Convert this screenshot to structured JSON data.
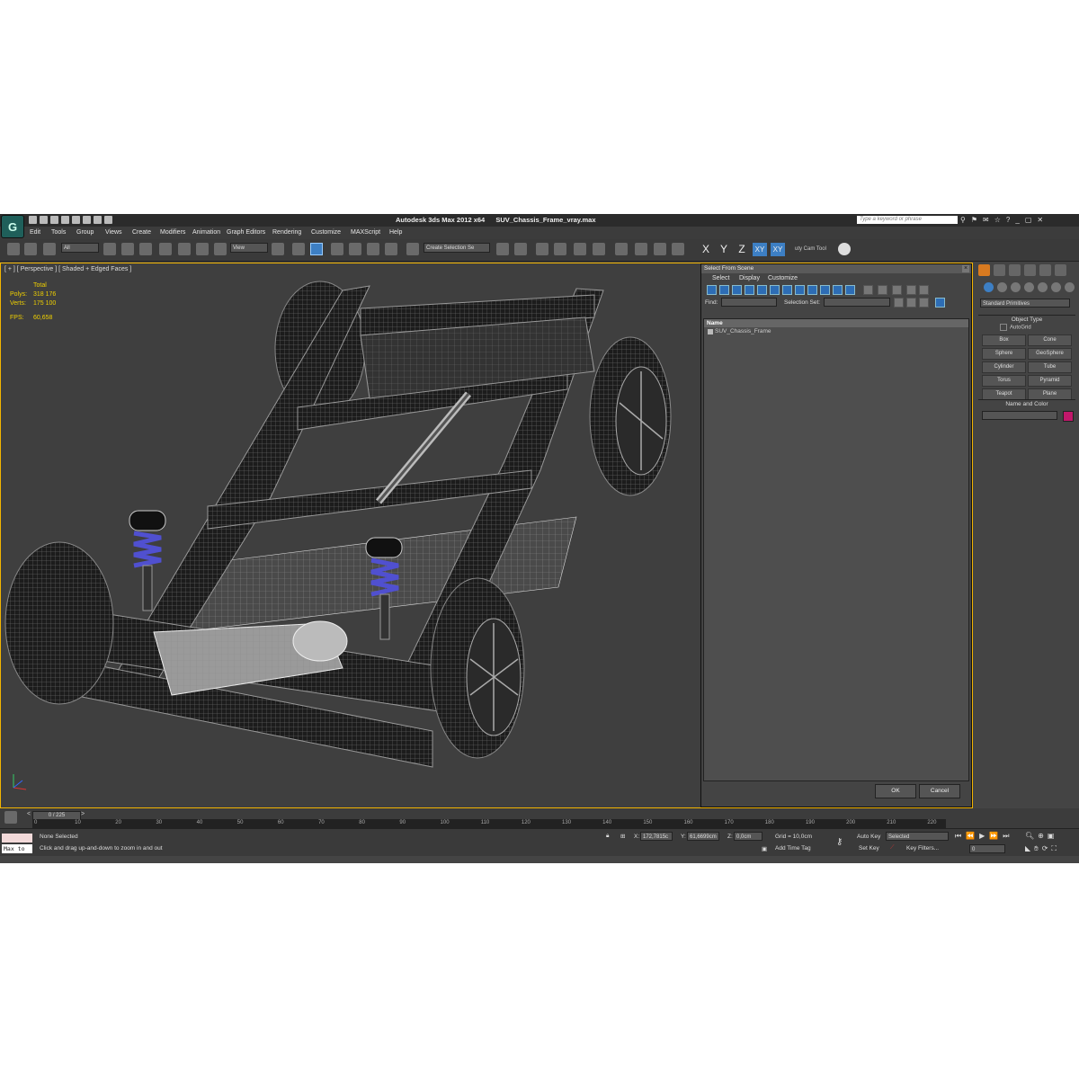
{
  "titlebar": {
    "app": "Autodesk 3ds Max  2012 x64",
    "file": "SUV_Chassis_Frame_vray.max",
    "search_placeholder": "Type a keyword or phrase"
  },
  "menu": [
    "Edit",
    "Tools",
    "Group",
    "Views",
    "Create",
    "Modifiers",
    "Animation",
    "Graph Editors",
    "Rendering",
    "Customize",
    "MAXScript",
    "Help"
  ],
  "toolbar": {
    "filter": "All",
    "ref_coord": "View",
    "selection_set": "Create Selection Se",
    "axis": [
      "X",
      "Y",
      "Z",
      "XY",
      "XY"
    ],
    "plugin_label": "uty Cam Tool"
  },
  "viewport": {
    "label": "[ + ] [ Perspective ] [ Shaded + Edged Faces ]",
    "stats": {
      "header": "Total",
      "polys_label": "Polys:",
      "polys": "318 176",
      "verts_label": "Verts:",
      "verts": "175 100",
      "fps_label": "FPS:",
      "fps": "60,658"
    }
  },
  "dialog": {
    "title": "Select From Scene",
    "menu": [
      "Select",
      "Display",
      "Customize"
    ],
    "find_label": "Find:",
    "selection_set_label": "Selection Set:",
    "column": "Name",
    "items": [
      "SUV_Chassis_Frame"
    ],
    "ok": "OK",
    "cancel": "Cancel"
  },
  "command_panel": {
    "category": "Standard Primitives",
    "object_type_title": "Object Type",
    "autogrid": "AutoGrid",
    "primitives": [
      "Box",
      "Cone",
      "Sphere",
      "GeoSphere",
      "Cylinder",
      "Tube",
      "Torus",
      "Pyramid",
      "Teapot",
      "Plane"
    ],
    "name_color_title": "Name and Color",
    "color": "#c2186b"
  },
  "timeline": {
    "frame": "0 / 225",
    "ticks": [
      "0",
      "10",
      "20",
      "30",
      "40",
      "50",
      "60",
      "70",
      "80",
      "90",
      "100",
      "110",
      "120",
      "130",
      "140",
      "150",
      "160",
      "170",
      "180",
      "190",
      "200",
      "210",
      "220"
    ]
  },
  "status": {
    "maxscript_1": "",
    "maxscript_2": "Max to",
    "selection": "None Selected",
    "prompt": "Click and drag up-and-down to zoom in and out",
    "x_label": "X:",
    "x": "172,7815c",
    "y_label": "Y:",
    "y": "61,6699cm",
    "z_label": "Z:",
    "z": "0,0cm",
    "grid": "Grid = 10,0cm",
    "add_time_tag": "Add Time Tag",
    "auto_key": "Auto Key",
    "set_key": "Set Key",
    "key_mode": "Selected",
    "key_filters": "Key Filters...",
    "frame_field": "0"
  }
}
